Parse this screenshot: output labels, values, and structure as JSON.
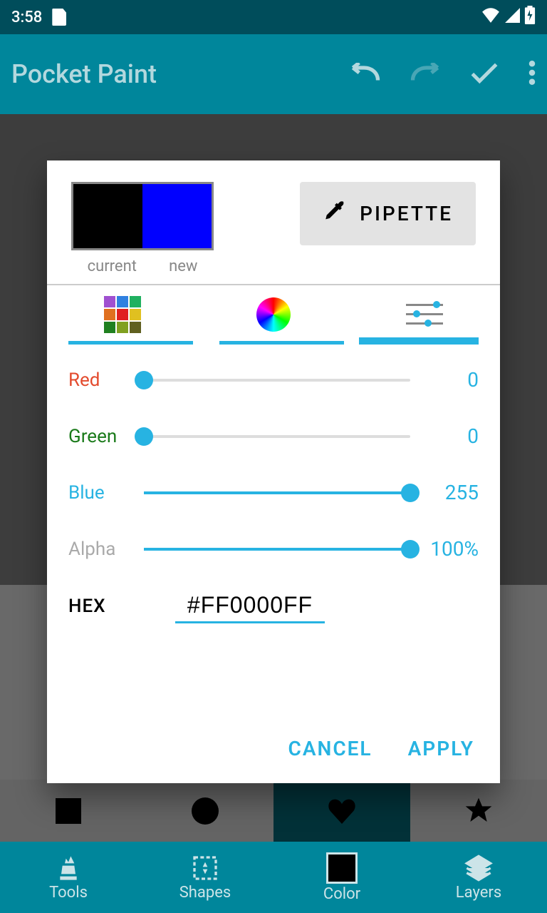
{
  "status": {
    "time": "3:58"
  },
  "app": {
    "title": "Pocket Paint"
  },
  "dialog": {
    "current_label": "current",
    "new_label": "new",
    "current_color": "#000000",
    "new_color": "#0000FF",
    "pipette_label": "PIPETTE",
    "sliders": {
      "red": {
        "label": "Red",
        "value": "0",
        "percent": 0,
        "color": "#e34b2e"
      },
      "green": {
        "label": "Green",
        "value": "0",
        "percent": 0,
        "color": "#1a7a1a"
      },
      "blue": {
        "label": "Blue",
        "value": "255",
        "percent": 100,
        "color": "#27b3e2"
      },
      "alpha": {
        "label": "Alpha",
        "value": "100%",
        "percent": 100,
        "color": "#aaaaaa"
      }
    },
    "hex_label": "HEX",
    "hex_value": "#FF0000FF",
    "cancel": "CANCEL",
    "apply": "APPLY"
  },
  "bottom_nav": {
    "tools": "Tools",
    "shapes": "Shapes",
    "color": "Color",
    "layers": "Layers"
  }
}
